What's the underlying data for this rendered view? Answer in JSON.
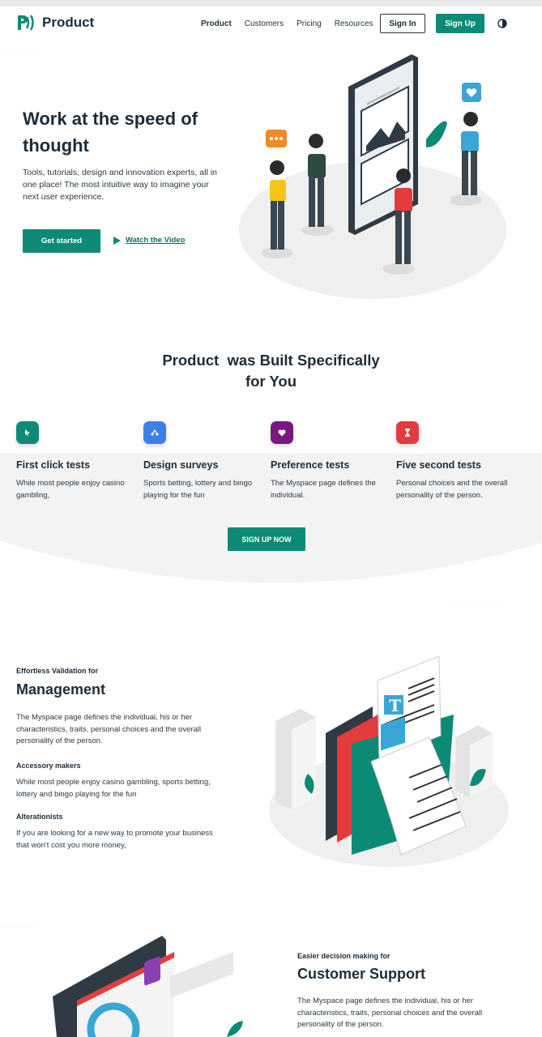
{
  "nav": {
    "logo_text": "Product",
    "links": [
      "Product",
      "Customers",
      "Pricing",
      "Resources"
    ],
    "signin_label": "Sign In",
    "signup_label": "Sign Up"
  },
  "hero": {
    "title": "Work at the speed of thought",
    "description": "Tools, tutorials, design and innovation experts, all in one place! The most intuitive way to imagine your next user experience.",
    "cta_label": "Get started",
    "video_label": "Watch the Video"
  },
  "features": {
    "title_line1": "Product  was Built Specifically",
    "title_line2": "for You",
    "items": [
      {
        "title": "First click tests",
        "desc": "While most people enjoy casino gambling,",
        "color": "#0c8a76",
        "icon": "cursor-icon"
      },
      {
        "title": "Design surveys",
        "desc": "Sports betting, lottery and bingo playing for the fun",
        "color": "#3f7ee8",
        "icon": "survey-icon"
      },
      {
        "title": "Preference tests",
        "desc": "The Myspace page defines the individual.",
        "color": "#7a1880",
        "icon": "heart-icon"
      },
      {
        "title": "Five second tests",
        "desc": "Personal choices and the overall personality of the person.",
        "color": "#e23c3c",
        "icon": "hourglass-icon"
      }
    ],
    "cta_label": "SIGN UP NOW"
  },
  "management": {
    "kicker": "Effortless Validation for",
    "title": "Management",
    "description": "The Myspace page defines the individual, his or her characteristics, traits, personal choices and the overall personality of the person.",
    "sub1_title": "Accessory makers",
    "sub1_desc": "While most people enjoy casino gambling, sports betting, lottery and bingo playing for the fun",
    "sub2_title": "Alterationists",
    "sub2_desc": "If you are looking for a new way to promote your business that won't cost you more money,"
  },
  "support": {
    "kicker": "Easier decision making for",
    "title": "Customer Support",
    "description": "The Myspace page defines the individual, his or her characteristics, traits, personal choices and the overall personality of the person."
  },
  "colors": {
    "accent": "#0c8a76",
    "heading": "#1d2c38",
    "red": "#e23c3c",
    "blue": "#3f7ee8",
    "purple": "#7a1880"
  }
}
